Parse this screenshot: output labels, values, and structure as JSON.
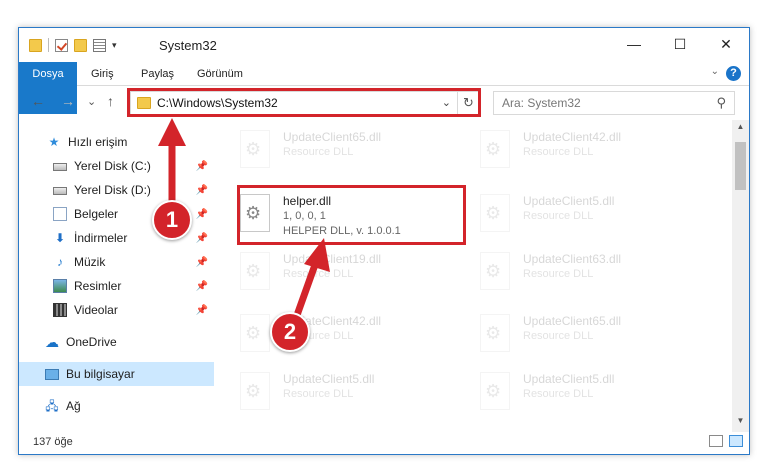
{
  "window": {
    "title": "System32"
  },
  "qat": {
    "dropdown": "▾"
  },
  "controls": {
    "minimize": "—",
    "maximize": "☐",
    "close": "✕"
  },
  "ribbon": {
    "tabs": [
      "Dosya",
      "Giriş",
      "Paylaş",
      "Görünüm"
    ],
    "help": "?",
    "collapse": "⌄"
  },
  "nav": {
    "back": "←",
    "forward": "→",
    "recent": "⌄",
    "up": "↑",
    "address": "C:\\Windows\\System32",
    "address_dropdown": "⌄",
    "refresh": "↻",
    "search_placeholder": "Ara: System32",
    "search_icon": "⚲"
  },
  "sidebar": {
    "quick_access": "Hızlı erişim",
    "items": [
      {
        "label": "Yerel Disk (C:)",
        "icon": "drive-icon",
        "pinned": true
      },
      {
        "label": "Yerel Disk (D:)",
        "icon": "drive-icon",
        "pinned": true
      },
      {
        "label": "Belgeler",
        "icon": "documents-icon",
        "pinned": true
      },
      {
        "label": "İndirmeler",
        "icon": "downloads-icon",
        "pinned": true
      },
      {
        "label": "Müzik",
        "icon": "music-icon",
        "pinned": true
      },
      {
        "label": "Resimler",
        "icon": "pictures-icon",
        "pinned": true
      },
      {
        "label": "Videolar",
        "icon": "videos-icon",
        "pinned": true
      }
    ],
    "onedrive": "OneDrive",
    "this_pc": "Bu bilgisayar",
    "network": "Ağ"
  },
  "files": [
    {
      "name": "UpdateClient65.dll",
      "line1": "Resource DLL",
      "line2": ""
    },
    {
      "name": "UpdateClient42.dll",
      "line1": "Resource DLL",
      "line2": ""
    },
    {
      "name": "helper.dll",
      "line1": "1, 0, 0, 1",
      "line2": "HELPER DLL, v. 1.0.0.1"
    },
    {
      "name": "UpdateClient5.dll",
      "line1": "Resource DLL",
      "line2": ""
    },
    {
      "name": "UpdateClient19.dll",
      "line1": "Resource DLL",
      "line2": ""
    },
    {
      "name": "UpdateClient63.dll",
      "line1": "Resource DLL",
      "line2": ""
    },
    {
      "name": "UpdateClient42.dll",
      "line1": "Resource DLL",
      "line2": ""
    },
    {
      "name": "UpdateClient65.dll",
      "line1": "Resource DLL",
      "line2": ""
    },
    {
      "name": "UpdateClient5.dll",
      "line1": "Resource DLL",
      "line2": ""
    },
    {
      "name": "UpdateClient5.dll",
      "line1": "Resource DLL",
      "line2": ""
    }
  ],
  "status": {
    "count": "137 öğe"
  },
  "annotations": {
    "step1": "1",
    "step2": "2"
  },
  "colors": {
    "accent": "#1979ca",
    "highlight": "#d3242a",
    "selection": "#cce8ff"
  }
}
